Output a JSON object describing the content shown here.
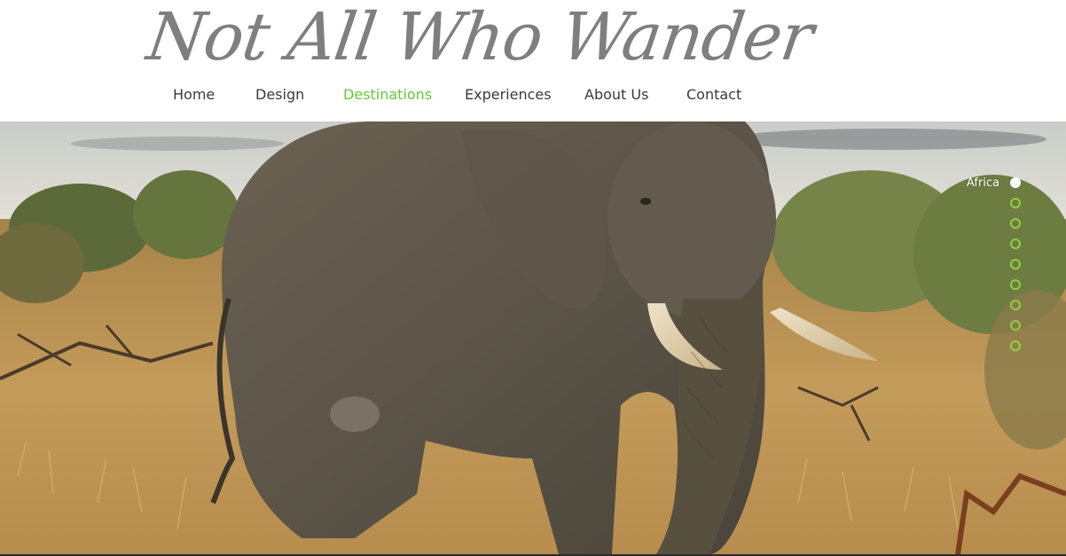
{
  "site": {
    "title": "Not All Who Wander"
  },
  "nav": {
    "items": [
      {
        "label": "Home",
        "active": false
      },
      {
        "label": "Design",
        "active": false
      },
      {
        "label": "Destinations",
        "active": true
      },
      {
        "label": "Experiences",
        "active": false
      },
      {
        "label": "About Us",
        "active": false
      },
      {
        "label": "Contact",
        "active": false
      }
    ],
    "active_color": "#63c93a",
    "text_color": "#3a3a3a"
  },
  "hero": {
    "image_subject": "elephant-in-savanna"
  },
  "anchor_menu": {
    "active_label": "Africa",
    "item_count": 9,
    "active_index": 0,
    "dot_color": "#8fd13f"
  },
  "colors": {
    "title_gray": "#7f7f7f",
    "header_bg": "#ffffff"
  }
}
